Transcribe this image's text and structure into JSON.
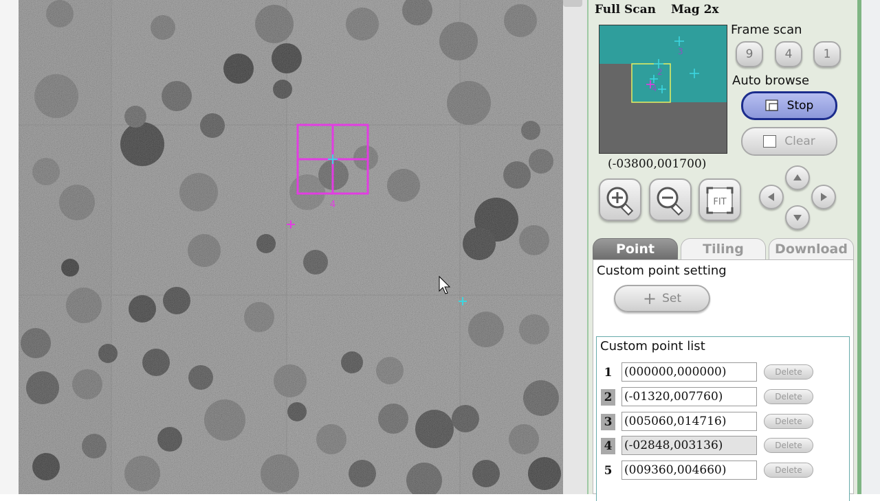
{
  "viewer": {
    "cursor_icon": "arrow-cursor-icon",
    "selection_marker_label": "4",
    "colors": {
      "frame": "#e23de2",
      "cross": "#3cd6e0"
    }
  },
  "panel": {
    "scan_mode": "Full Scan",
    "magnification": "Mag 2x",
    "overview_labels": [
      "3",
      "2",
      "4"
    ],
    "overview_colors": {
      "teal": "#2f9e9c",
      "gray": "#666666",
      "frame": "#e8f060"
    },
    "position_readout": "(-03800,001700)",
    "frame_scan": {
      "label": "Frame scan",
      "options": [
        "9",
        "4",
        "1"
      ]
    },
    "auto_browse": {
      "label": "Auto browse",
      "stop_label": "Stop",
      "clear_label": "Clear"
    },
    "tools": {
      "zoom_in_icon": "zoom-in-icon",
      "zoom_out_icon": "zoom-out-icon",
      "fit_label": "FIT"
    },
    "tabs": [
      "Point",
      "Tiling",
      "Download"
    ],
    "active_tab": "Point",
    "point": {
      "setting_title": "Custom point setting",
      "set_label": "Set",
      "list_title": "Custom point list",
      "delete_label": "Delete",
      "items": [
        {
          "num": "1",
          "coords": "(000000,000000)"
        },
        {
          "num": "2",
          "coords": "(-01320,007760)"
        },
        {
          "num": "3",
          "coords": "(005060,014716)"
        },
        {
          "num": "4",
          "coords": "(-02848,003136)"
        },
        {
          "num": "5",
          "coords": "(009360,004660)"
        }
      ]
    }
  }
}
